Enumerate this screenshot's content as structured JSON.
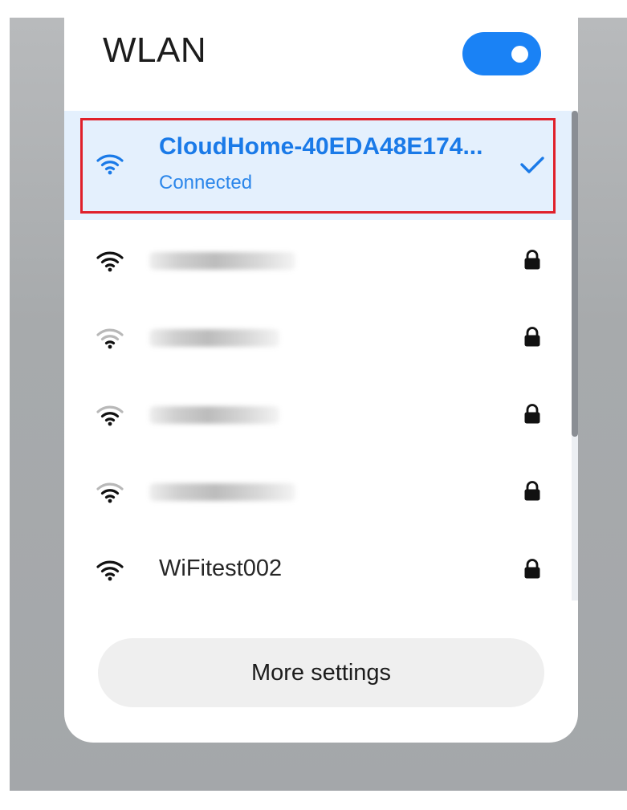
{
  "wlan_panel": {
    "title": "WLAN",
    "toggle_on": true,
    "accent_color": "#1a82f5",
    "highlight_color": "#e0202a"
  },
  "networks": [
    {
      "ssid": "CloudHome-40EDA48E174...",
      "status": "Connected",
      "connected": true,
      "secured": false,
      "icon": "wifi-full-icon",
      "trailing_icon": "checkmark-icon"
    },
    {
      "ssid": "",
      "obscured": true,
      "secured": true,
      "icon": "wifi-full-icon",
      "trailing_icon": "lock-icon"
    },
    {
      "ssid": "",
      "obscured": true,
      "secured": true,
      "icon": "wifi-weak-icon",
      "trailing_icon": "lock-icon"
    },
    {
      "ssid": "",
      "obscured": true,
      "secured": true,
      "icon": "wifi-medium-icon",
      "trailing_icon": "lock-icon"
    },
    {
      "ssid": "",
      "obscured": true,
      "secured": true,
      "icon": "wifi-medium-icon",
      "trailing_icon": "lock-icon"
    },
    {
      "ssid": "WiFitest002",
      "secured": true,
      "icon": "wifi-full-icon",
      "trailing_icon": "lock-icon"
    }
  ],
  "footer": {
    "more_settings_label": "More settings"
  }
}
